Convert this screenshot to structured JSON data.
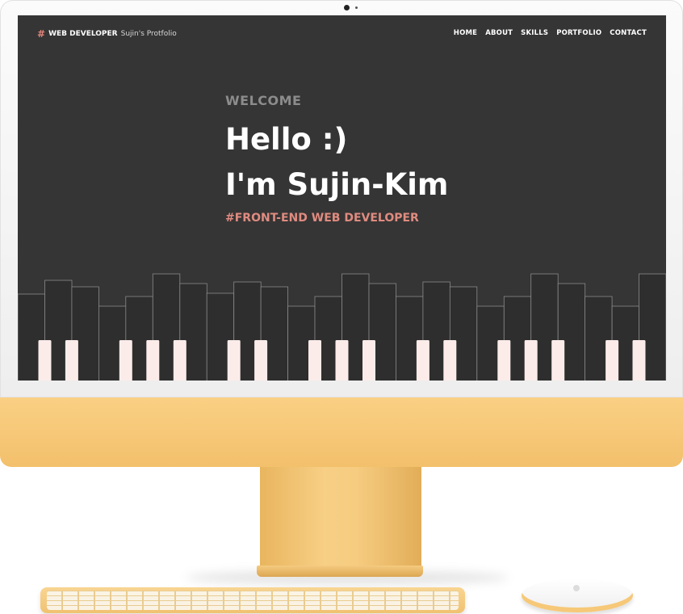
{
  "site": {
    "logo_strong": "WEB DEVELOPER",
    "logo_light": "Sujin's Protfolio",
    "nav": [
      "HOME",
      "ABOUT",
      "SKILLS",
      "PORTFOLIO",
      "CONTACT"
    ]
  },
  "hero": {
    "welcome": "WELCOME",
    "line1": "Hello :)",
    "line2": "I'm Sujin-Kim",
    "subtitle": "#FRONT-END WEB DEVELOPER"
  },
  "colors": {
    "screen_bg": "#353535",
    "accent": "#e08b80",
    "frame_yellow": "#f6c878",
    "piano_key_light": "#fbecea"
  }
}
